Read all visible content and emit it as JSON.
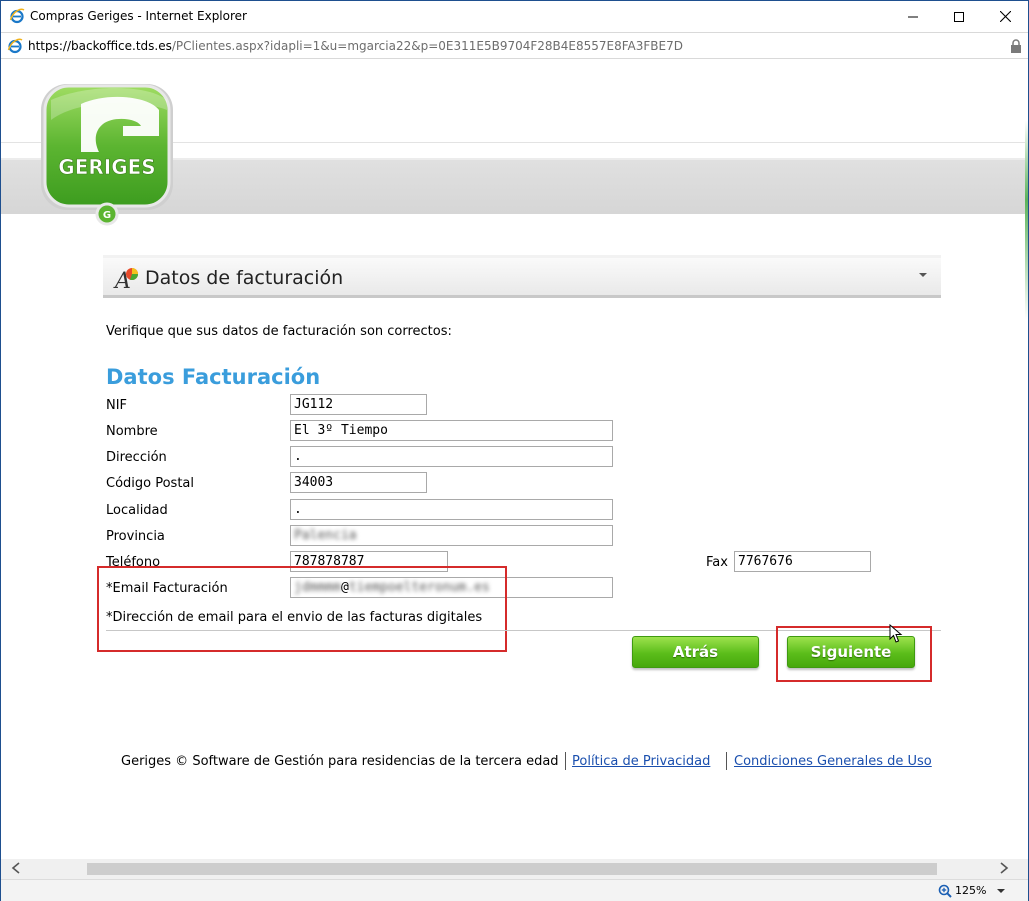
{
  "window": {
    "title": "Compras Geriges - Internet Explorer",
    "minimize_glyph": "—",
    "maximize_glyph": "☐",
    "close_glyph": "✕"
  },
  "address": {
    "scheme_host": "https://backoffice.tds.es",
    "path": "/PClientes.aspx?idapli=1&u=mgarcia22&p=0E311E5B9704F28B4E8557E8FA3FBE7D"
  },
  "logo": {
    "text": "GERIGES",
    "color": "#5cb531"
  },
  "section": {
    "title": "Datos de facturación"
  },
  "intro": "Verifique que sus datos de facturación son correctos:",
  "form": {
    "heading": "Datos Facturación",
    "fields": {
      "nif": {
        "label": "NIF",
        "value": "JG112"
      },
      "nombre": {
        "label": "Nombre",
        "value": "El 3º Tiempo"
      },
      "direccion": {
        "label": "Dirección",
        "value": "."
      },
      "codigo_postal": {
        "label": "Código Postal",
        "value": "34003"
      },
      "localidad": {
        "label": "Localidad",
        "value": "."
      },
      "provincia": {
        "label": "Provincia",
        "value": "Palencia"
      },
      "telefono": {
        "label": "Teléfono",
        "value": "787878787"
      },
      "fax": {
        "label": "Fax",
        "value": "7767676"
      },
      "email": {
        "label": "*Email Facturación",
        "value_user": "jdmmmm",
        "value_at": "@",
        "value_domain": "tiempoelteronum.es"
      }
    },
    "note": "*Dirección de email para el envio de las facturas digitales"
  },
  "buttons": {
    "back": "Atrás",
    "next": "Siguiente"
  },
  "footer": {
    "text": "Geriges © Software de Gestión para residencias de la tercera edad",
    "privacy": "Política de Privacidad",
    "terms": "Condiciones Generales de Uso"
  },
  "statusbar": {
    "zoom": "125%"
  },
  "colors": {
    "accent": "#3a9ddc",
    "button_green": "#5bbd1a",
    "highlight_red": "#d52b2b",
    "link": "#1a4fae"
  }
}
